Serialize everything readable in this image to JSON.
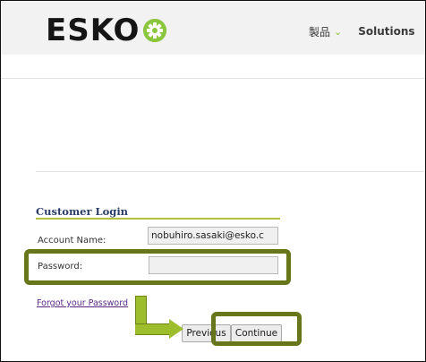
{
  "header": {
    "logo_text": "ESKO",
    "logo_mark_icon": "esko-star-logo",
    "nav": {
      "products_label": "製品",
      "products_chevron": "⌄",
      "solutions_label": "Solutions"
    }
  },
  "login": {
    "title": "Customer Login",
    "account_name_label": "Account Name:",
    "account_name_value": "nobuhiro.sasaki@esko.c",
    "password_label": "Password:",
    "password_value": "",
    "forgot_link": "Forgot your Password",
    "previous_button": "Previous",
    "continue_button": "Continue"
  },
  "colors": {
    "accent_green": "#8cc63f",
    "highlight_olive": "#67761b",
    "arrow_green": "#9ebd2c"
  }
}
